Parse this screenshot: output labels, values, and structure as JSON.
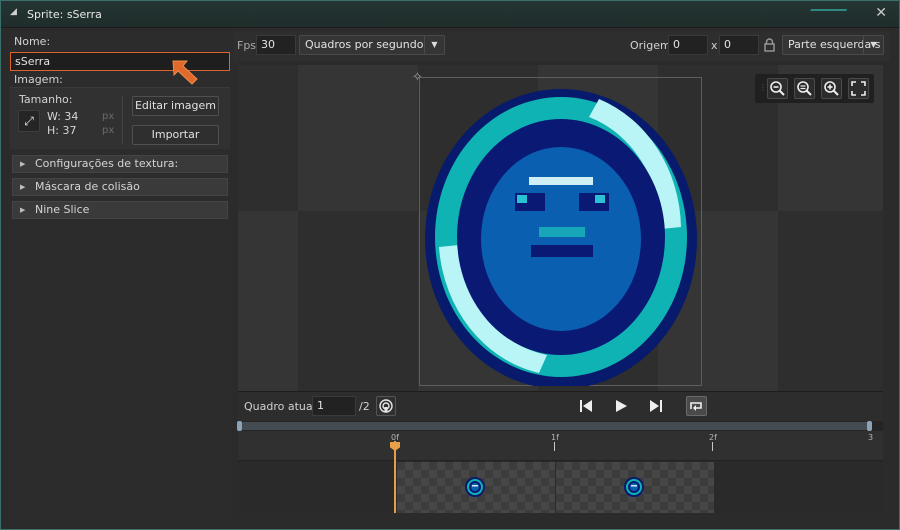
{
  "window": {
    "title": "Sprite: sSerra",
    "collapse_icon": "triangle-down-icon",
    "close_icon": "close-icon"
  },
  "left_panel": {
    "name_label": "Nome:",
    "name_value": "sSerra",
    "image_label": "Imagem:",
    "size_label": "Tamanho:",
    "width_text": "W: 34",
    "height_text": "H: 37",
    "unit": "px",
    "edit_image_button": "Editar imagem",
    "import_button": "Importar",
    "sections": [
      "Configurações de textura:",
      "Máscara de colisão",
      "Nine Slice"
    ]
  },
  "toolbar": {
    "fps_label": "Fps",
    "fps_value": "30",
    "fps_mode": "Quadros por segundo",
    "origin_label": "Origem",
    "origin_x": "0",
    "origin_sep": "x",
    "origin_y": "0",
    "origin_preset": "Parte esquerda s"
  },
  "playback": {
    "current_frame_label": "Quadro atual:",
    "current_frame_value": "1",
    "frame_total": "/2"
  },
  "timeline": {
    "ticks": [
      "0f",
      "1f",
      "2f",
      "3"
    ]
  },
  "colors": {
    "accent": "#d9652b",
    "playhead": "#e8a048",
    "window_border": "#3b6f6a"
  }
}
